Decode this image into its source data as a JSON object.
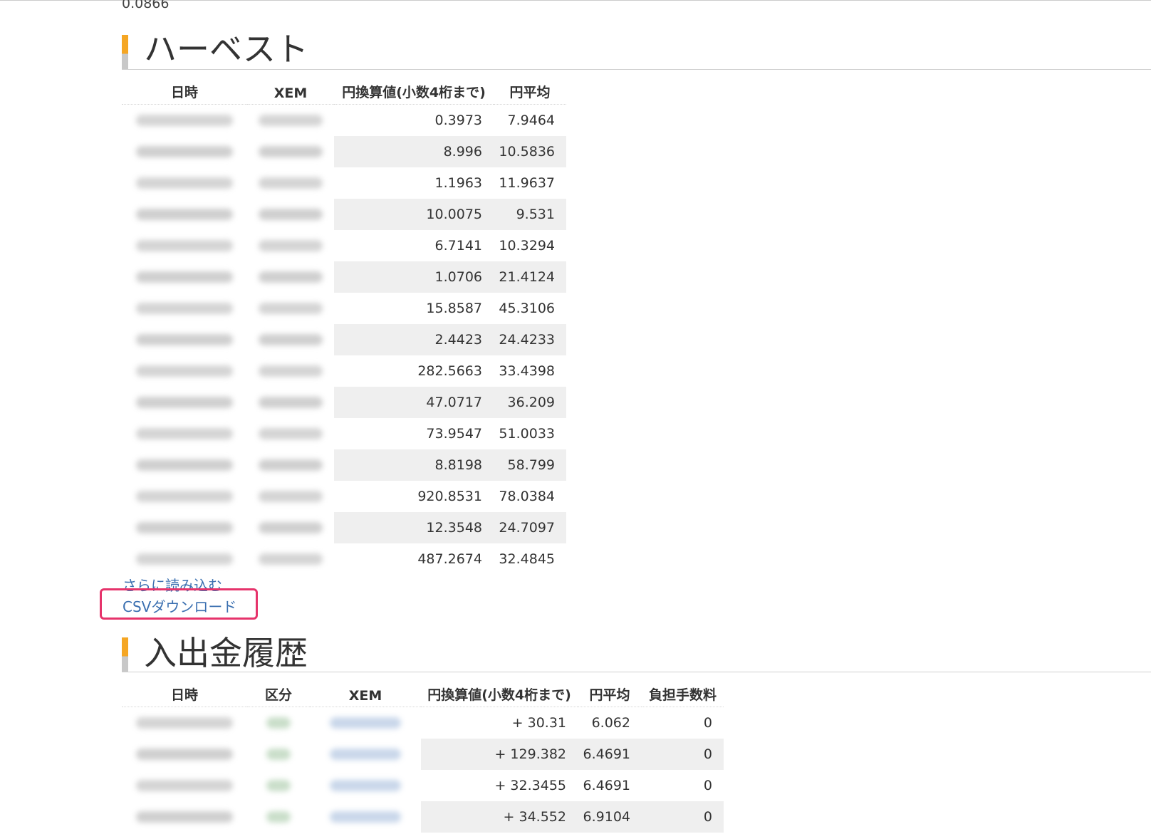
{
  "previous_value": "0.0866",
  "harvest": {
    "title": "ハーベスト",
    "headers": [
      "日時",
      "XEM",
      "円換算値(小数4桁まで)",
      "円平均"
    ],
    "rows": [
      {
        "jpy": "0.3973",
        "avg": "7.9464"
      },
      {
        "jpy": "8.996",
        "avg": "10.5836"
      },
      {
        "jpy": "1.1963",
        "avg": "11.9637"
      },
      {
        "jpy": "10.0075",
        "avg": "9.531"
      },
      {
        "jpy": "6.7141",
        "avg": "10.3294"
      },
      {
        "jpy": "1.0706",
        "avg": "21.4124"
      },
      {
        "jpy": "15.8587",
        "avg": "45.3106"
      },
      {
        "jpy": "2.4423",
        "avg": "24.4233"
      },
      {
        "jpy": "282.5663",
        "avg": "33.4398"
      },
      {
        "jpy": "47.0717",
        "avg": "36.209"
      },
      {
        "jpy": "73.9547",
        "avg": "51.0033"
      },
      {
        "jpy": "8.8198",
        "avg": "58.799"
      },
      {
        "jpy": "920.8531",
        "avg": "78.0384"
      },
      {
        "jpy": "12.3548",
        "avg": "24.7097"
      },
      {
        "jpy": "487.2674",
        "avg": "32.4845"
      }
    ],
    "load_more": "さらに読み込む",
    "csv_download": "CSVダウンロード"
  },
  "deposits": {
    "title": "入出金履歴",
    "headers": [
      "日時",
      "区分",
      "XEM",
      "円換算値(小数4桁まで)",
      "円平均",
      "負担手数料"
    ],
    "rows": [
      {
        "jpy": "+ 30.31",
        "avg": "6.062",
        "fee": "0"
      },
      {
        "jpy": "+ 129.382",
        "avg": "6.4691",
        "fee": "0"
      },
      {
        "jpy": "+ 32.3455",
        "avg": "6.4691",
        "fee": "0"
      },
      {
        "jpy": "+ 34.552",
        "avg": "6.9104",
        "fee": "0"
      }
    ]
  },
  "colors": {
    "accent": "#f5a623",
    "link": "#3a6fb0",
    "highlight": "#e6336b"
  }
}
